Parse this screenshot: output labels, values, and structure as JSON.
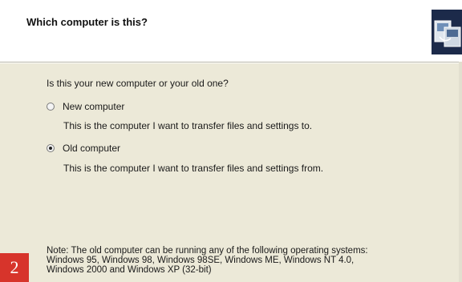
{
  "header": {
    "title": "Which computer is this?",
    "icon": "computer-transfer-icon"
  },
  "main": {
    "question": "Is this your new computer or your old one?",
    "options": [
      {
        "label": "New computer",
        "description": "This is the computer I want to transfer files and settings to.",
        "selected": false
      },
      {
        "label": "Old computer",
        "description": "This is the computer I want to transfer files and settings from.",
        "selected": true
      }
    ],
    "note": {
      "line1": "Note: The old computer can be running any of the following operating systems:",
      "line2": "Windows 95, Windows 98, Windows 98SE, Windows ME, Windows NT 4.0,",
      "line3": "Windows 2000 and Windows XP (32-bit)"
    }
  },
  "badge": {
    "text": "2",
    "color": "#d7342b"
  }
}
